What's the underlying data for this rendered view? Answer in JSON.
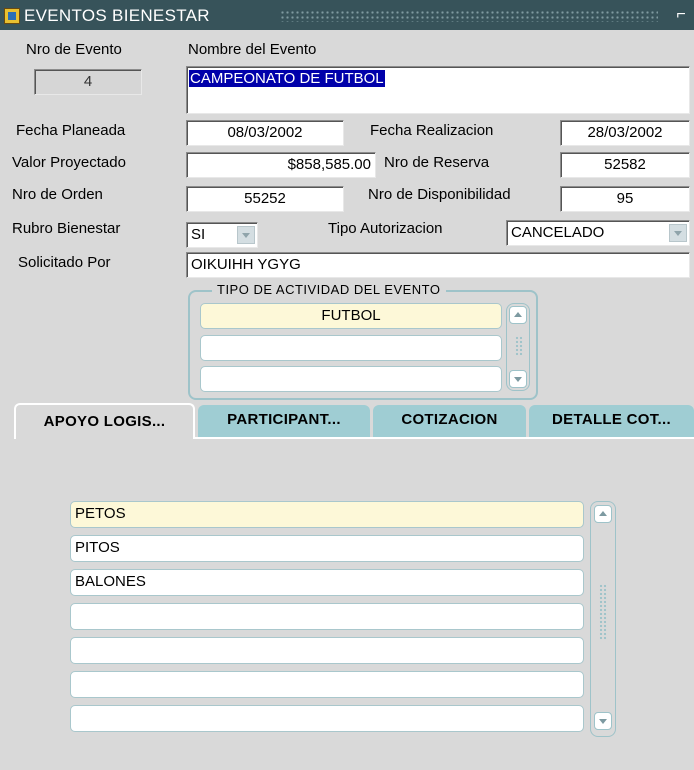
{
  "window": {
    "title": "EVENTOS BIENESTAR",
    "icon": "app-form-icon",
    "control": "⌐"
  },
  "header_labels": {
    "event_no": "Nro de Evento",
    "event_name": "Nombre del Evento"
  },
  "fields": {
    "event_no": "4",
    "event_name": "CAMPEONATO DE FUTBOL",
    "fecha_planeada_label": "Fecha Planeada",
    "fecha_planeada": "08/03/2002",
    "fecha_realizacion_label": "Fecha Realizacion",
    "fecha_realizacion": "28/03/2002",
    "valor_proyectado_label": "Valor Proyectado",
    "valor_proyectado": "$858,585.00",
    "nro_reserva_label": "Nro de Reserva",
    "nro_reserva": "52582",
    "nro_orden_label": "Nro de Orden",
    "nro_orden": "55252",
    "nro_disponibilidad_label": "Nro de Disponibilidad",
    "nro_disponibilidad": "95",
    "rubro_bienestar_label": "Rubro Bienestar",
    "rubro_bienestar": "SI",
    "tipo_autorizacion_label": "Tipo Autorizacion",
    "tipo_autorizacion": "CANCELADO",
    "solicitado_por_label": "Solicitado Por",
    "solicitado_por": "OIKUIHH YGYG"
  },
  "activity_group": {
    "title": "TIPO DE ACTIVIDAD DEL EVENTO",
    "rows": [
      "FUTBOL",
      "",
      ""
    ]
  },
  "tabs": [
    {
      "label": "APOYO LOGIS...",
      "active": true
    },
    {
      "label": "PARTICIPANT...",
      "active": false
    },
    {
      "label": "COTIZACION",
      "active": false
    },
    {
      "label": "DETALLE COT...",
      "active": false
    }
  ],
  "apoyo_items": [
    "PETOS",
    "PITOS",
    "BALONES",
    "",
    "",
    "",
    ""
  ],
  "colors": {
    "titlebar": "#37535a",
    "tab_inactive": "#9fcdd3",
    "selection": "#0000aa",
    "current_record": "#fdf8d8"
  }
}
